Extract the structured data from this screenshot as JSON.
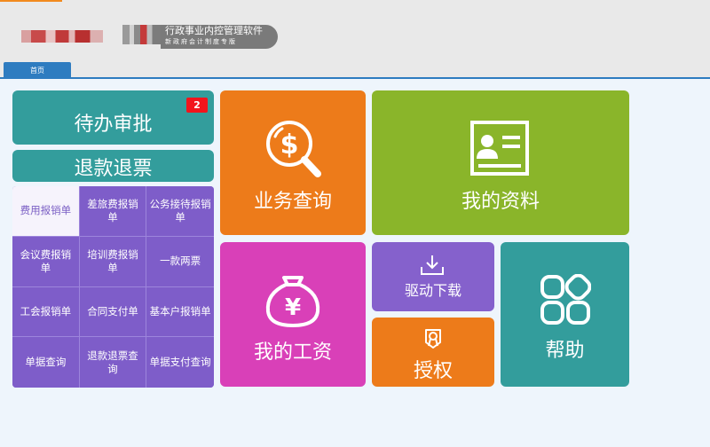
{
  "header": {
    "product_title": "行政事业内控管理软件",
    "product_subtitle": "新政府会计制度专版",
    "tab_home": "首页"
  },
  "tiles": {
    "pending_approval": {
      "label": "待办审批",
      "badge": "2"
    },
    "refund": {
      "label": "退款退票"
    },
    "business_query": {
      "label": "业务查询"
    },
    "my_profile": {
      "label": "我的资料"
    },
    "my_salary": {
      "label": "我的工资"
    },
    "driver_download": {
      "label": "驱动下载"
    },
    "authorize": {
      "label": "授权"
    },
    "help": {
      "label": "帮助"
    }
  },
  "menu": {
    "items": [
      {
        "label": "费用报销单"
      },
      {
        "label": "差旅费报销单"
      },
      {
        "label": "公务接待报销单"
      },
      {
        "label": "会议费报销单"
      },
      {
        "label": "培训费报销单"
      },
      {
        "label": "一款两票"
      },
      {
        "label": "工会报销单"
      },
      {
        "label": "合同支付单"
      },
      {
        "label": "基本户报销单"
      },
      {
        "label": "单据查询"
      },
      {
        "label": "退款退票查询"
      },
      {
        "label": "单据支付查询"
      }
    ]
  },
  "colors": {
    "teal": "#339d9c",
    "orange": "#ed7b1a",
    "green": "#8ab52a",
    "magenta": "#d940b8",
    "purple": "#8561cc",
    "badge_red": "#f2141c",
    "tab_blue": "#2e7cc0"
  },
  "icons": {
    "business_query": "dollar-magnifier-icon",
    "my_profile": "id-card-icon",
    "my_salary": "yuan-money-bag-icon",
    "driver_download": "download-icon",
    "authorize": "certificate-ribbon-icon",
    "help": "four-rounded-squares-icon"
  }
}
